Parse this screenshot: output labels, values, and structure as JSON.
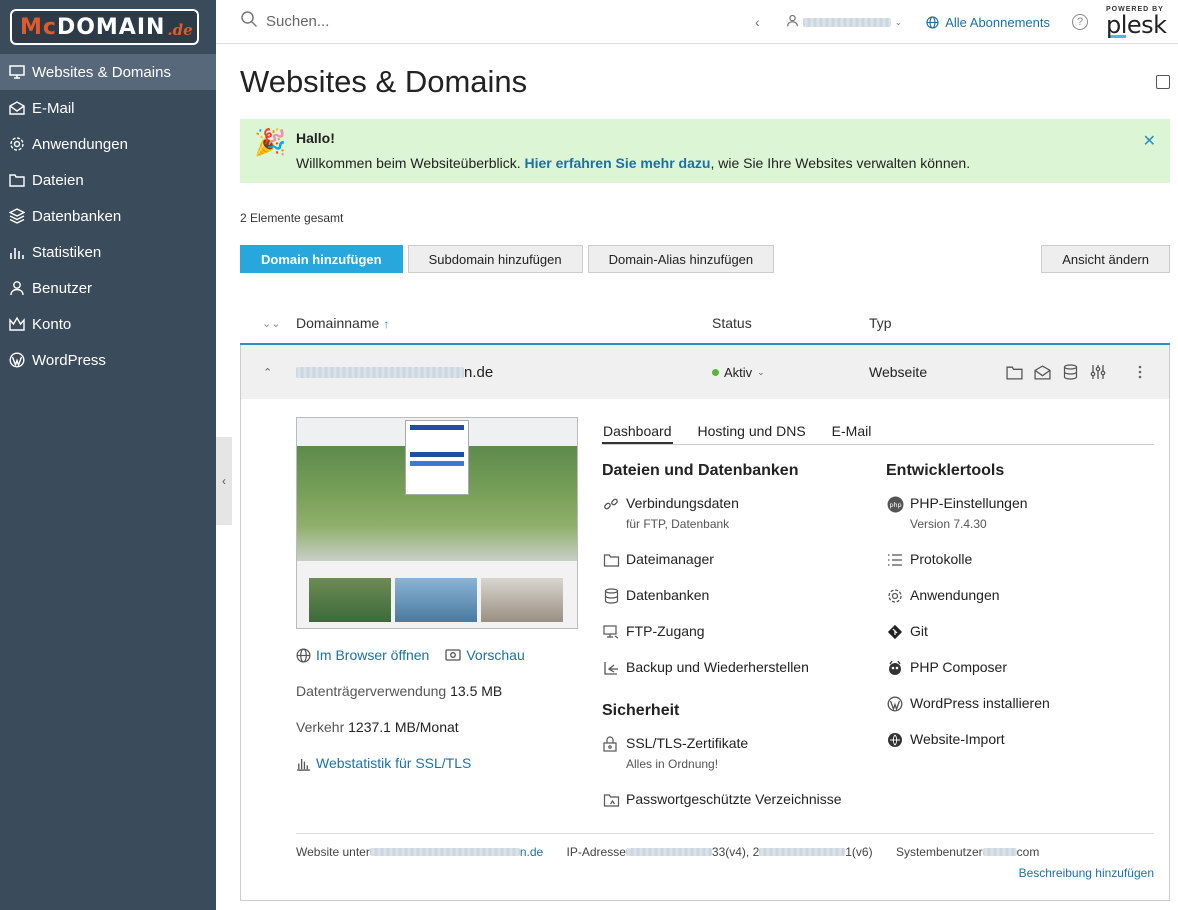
{
  "logo": {
    "part1": "Mc",
    "part2": "DOMAIN",
    "part3": ".de"
  },
  "sidebar": {
    "items": [
      {
        "label": "Websites & Domains",
        "icon": "monitor-icon",
        "active": true
      },
      {
        "label": "E-Mail",
        "icon": "mail-icon"
      },
      {
        "label": "Anwendungen",
        "icon": "gear-icon"
      },
      {
        "label": "Dateien",
        "icon": "folder-icon"
      },
      {
        "label": "Datenbanken",
        "icon": "layers-icon"
      },
      {
        "label": "Statistiken",
        "icon": "bar-chart-icon"
      },
      {
        "label": "Benutzer",
        "icon": "user-icon"
      },
      {
        "label": "Konto",
        "icon": "crown-icon"
      },
      {
        "label": "WordPress",
        "icon": "wordpress-icon"
      }
    ]
  },
  "topbar": {
    "search_placeholder": "Suchen...",
    "subscriptions_label": "Alle Abonnements",
    "help_label": "?",
    "powered_by": "POWERED BY",
    "brand": "plesk"
  },
  "page": {
    "title": "Websites & Domains"
  },
  "banner": {
    "title": "Hallo!",
    "text_before": "Willkommen beim Websiteüberblick. ",
    "link": "Hier erfahren Sie mehr dazu",
    "text_after": ", wie Sie Ihre Websites verwalten können.",
    "close": "✕"
  },
  "list": {
    "count_label": "2 Elemente gesamt"
  },
  "toolbar": {
    "add_domain": "Domain hinzufügen",
    "add_subdomain": "Subdomain hinzufügen",
    "add_alias": "Domain-Alias hinzufügen",
    "change_view": "Ansicht ändern"
  },
  "table": {
    "col_name": "Domainname",
    "sort_arrow": "↑",
    "col_status": "Status",
    "col_type": "Typ"
  },
  "domain": {
    "name_suffix": "n.de",
    "status": "Aktiv",
    "type": "Webseite",
    "open_browser": "Im Browser öffnen",
    "preview": "Vorschau",
    "disk_label": "Datenträgerverwendung",
    "disk_value": "13.5 MB",
    "traffic_label": "Verkehr",
    "traffic_value": "1237.1 MB/Monat",
    "webstat": "Webstatistik für SSL/TLS"
  },
  "tabs": [
    "Dashboard",
    "Hosting und DNS",
    "E-Mail"
  ],
  "files_section": {
    "title": "Dateien und Datenbanken",
    "items": [
      {
        "label": "Verbindungsdaten",
        "sub": "für FTP, Datenbank"
      },
      {
        "label": "Dateimanager"
      },
      {
        "label": "Datenbanken"
      },
      {
        "label": "FTP-Zugang"
      },
      {
        "label": "Backup und Wiederherstellen"
      }
    ]
  },
  "security_section": {
    "title": "Sicherheit",
    "items": [
      {
        "label": "SSL/TLS-Zertifikate",
        "sub": "Alles in Ordnung!"
      },
      {
        "label": "Passwortgeschützte Verzeichnisse"
      }
    ]
  },
  "dev_section": {
    "title": "Entwicklertools",
    "items": [
      {
        "label": "PHP-Einstellungen",
        "sub": "Version 7.4.30"
      },
      {
        "label": "Protokolle"
      },
      {
        "label": "Anwendungen"
      },
      {
        "label": "Git"
      },
      {
        "label": "PHP Composer"
      },
      {
        "label": "WordPress installieren"
      },
      {
        "label": "Website-Import"
      }
    ]
  },
  "footer": {
    "website_label": "Website unter",
    "website_suffix": "n.de",
    "ip_label": "IP-Adresse",
    "ip_v4_suffix": "33(v4), 2",
    "ip_v6_suffix": "1(v6)",
    "sysuser_label": "Systembenutzer",
    "sysuser_suffix": "com",
    "add_description": "Beschreibung hinzufügen"
  }
}
